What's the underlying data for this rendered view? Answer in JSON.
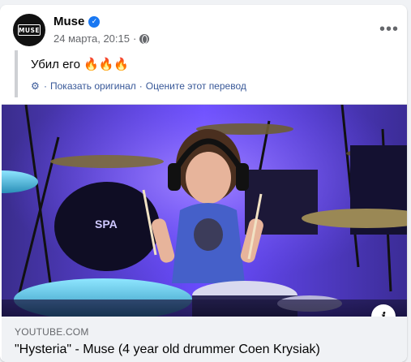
{
  "post": {
    "author": "Muse",
    "avatar_logo_text": "MUSE",
    "timestamp": "24 марта, 20:15",
    "meta_separator": "·",
    "text": "Убил его 🔥🔥🔥",
    "translation": {
      "show_original": "Показать оригинал",
      "separator": "·",
      "rate_translation": "Оцените этот перевод"
    },
    "more_label": "•••",
    "verified_mark": "✓"
  },
  "link_preview": {
    "domain": "YOUTUBE.COM",
    "title": "\"Hysteria\" - Muse (4 year old drummer Coen Krysiak)"
  },
  "icons": {
    "verified": "verified-badge-icon",
    "globe": "globe-icon",
    "gear": "gear-icon",
    "more": "more-options-icon",
    "info": "info-icon"
  },
  "colors": {
    "accent": "#1877f2",
    "link": "#385898",
    "muted": "#65676b",
    "stage_light": "#6a4cff"
  }
}
